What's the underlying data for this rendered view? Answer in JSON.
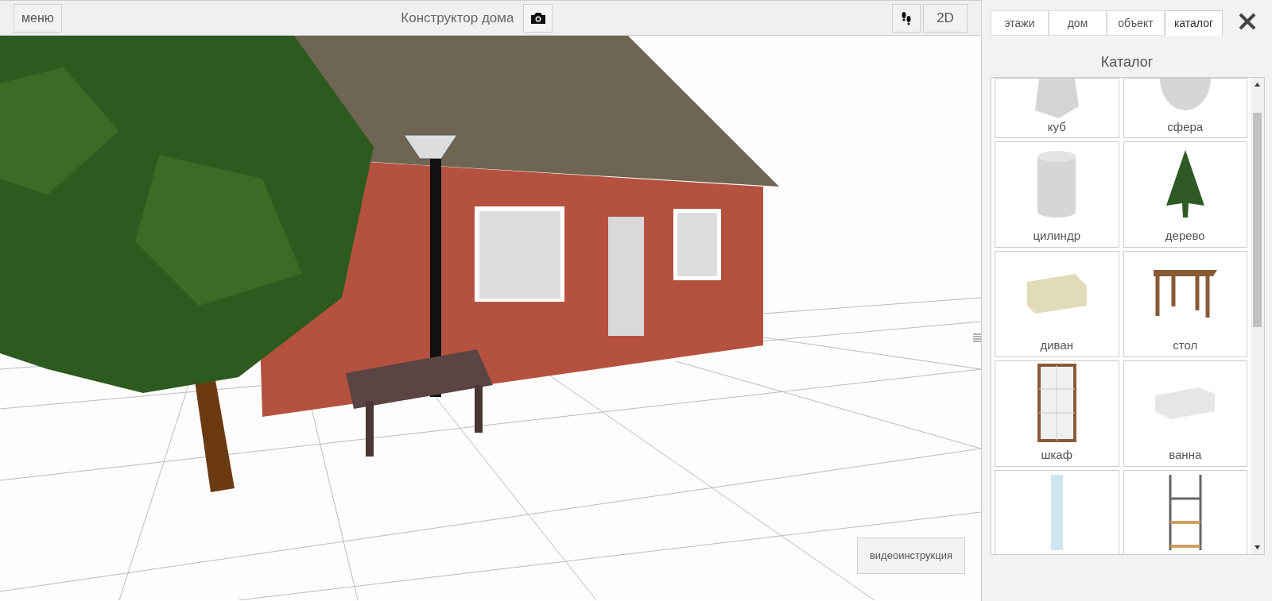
{
  "toolbar": {
    "menu_button": "меню",
    "title": "Конструктор дома",
    "view_2d_button": "2D"
  },
  "video_button": "видеоинструкция",
  "panel": {
    "tabs": [
      {
        "label": "этажи",
        "selected": false
      },
      {
        "label": "дом",
        "selected": false
      },
      {
        "label": "объект",
        "selected": false
      },
      {
        "label": "каталог",
        "selected": true
      }
    ],
    "heading": "Каталог",
    "catalog": [
      {
        "kind": "cube",
        "label": "куб"
      },
      {
        "kind": "sphere",
        "label": "сфера"
      },
      {
        "kind": "cylinder",
        "label": "цилиндр"
      },
      {
        "kind": "tree",
        "label": "дерево"
      },
      {
        "kind": "sofa",
        "label": "диван"
      },
      {
        "kind": "table",
        "label": "стол"
      },
      {
        "kind": "wardrobe",
        "label": "шкаф"
      },
      {
        "kind": "bath",
        "label": "ванна"
      },
      {
        "kind": "shower"
      },
      {
        "kind": "shelf"
      }
    ]
  }
}
